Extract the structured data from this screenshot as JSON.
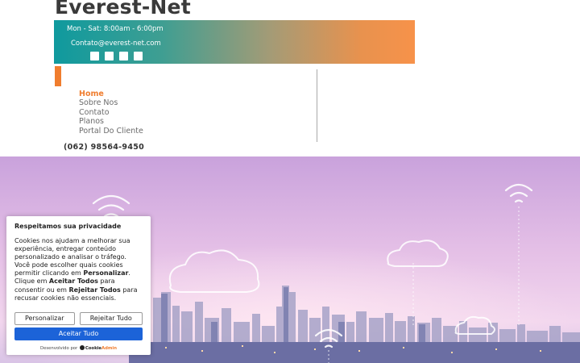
{
  "header": {
    "site_title": "Everest-Net",
    "hours": "Mon - Sat: 8:00am - 6:00pm",
    "email": "Contato@everest-net.com",
    "social_icons": [
      "social-icon-1",
      "social-icon-2",
      "social-icon-3",
      "social-icon-4"
    ],
    "accent_color": "#f07d2e",
    "gradient_start": "#0f9a9e",
    "gradient_end": "#f7924a"
  },
  "nav": {
    "items": [
      {
        "label": "Home",
        "active": true
      },
      {
        "label": "Sobre Nos",
        "active": false
      },
      {
        "label": "Contato",
        "active": false
      },
      {
        "label": "Planos",
        "active": false
      },
      {
        "label": "Portal Do Cliente",
        "active": false
      }
    ]
  },
  "phone": "(062) 98564-9450",
  "cookie_banner": {
    "title": "Respeitamos sua privacidade",
    "body_part1": "Cookies nos ajudam a melhorar sua experiência, entregar conteúdo personalizado e analisar o tráfego. Você pode escolher quais cookies permitir clicando em ",
    "body_bold1": "Personalizar",
    "body_part2": ". Clique em ",
    "body_bold2": "Aceitar Todos",
    "body_part3": " para consentir ou em ",
    "body_bold3": "Rejeitar Todos",
    "body_part4": " para recusar cookies não essenciais.",
    "customize_label": "Personalizar",
    "reject_label": "Rejeitar Tudo",
    "accept_label": "Aceitar Tudo",
    "powered_prefix": "Desenvolvido por",
    "powered_brand_dark": "Cookie",
    "powered_brand_orange": "Admin",
    "accept_color": "#1c63d8"
  }
}
